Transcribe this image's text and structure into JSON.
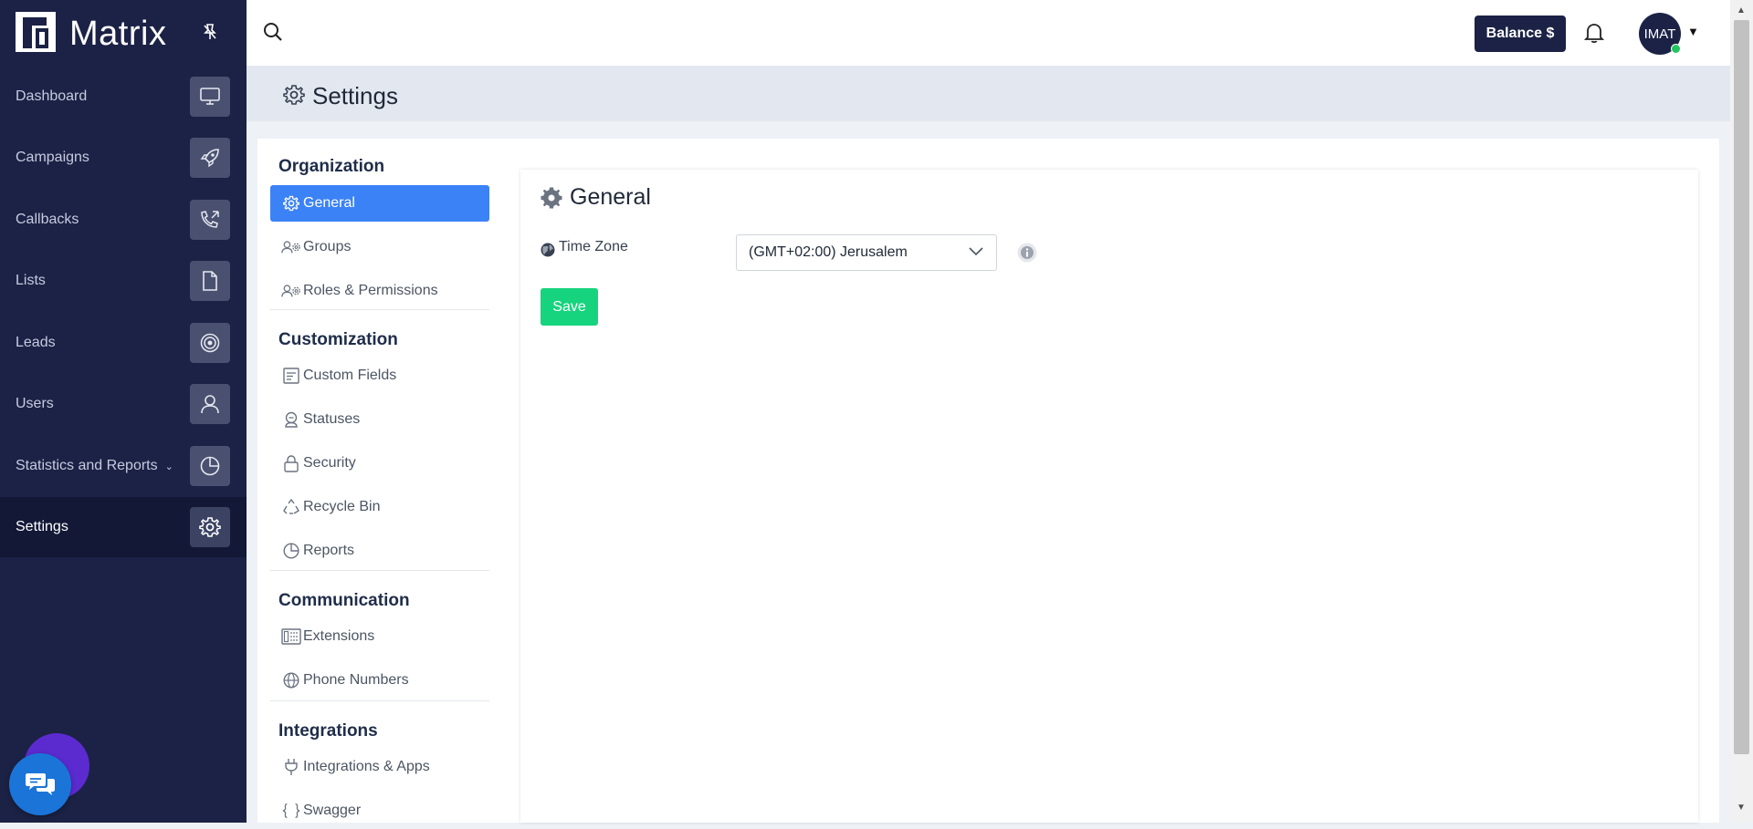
{
  "app": {
    "name": "Matrix"
  },
  "sidebar": {
    "items": [
      {
        "label": "Dashboard",
        "icon": "monitor-icon"
      },
      {
        "label": "Campaigns",
        "icon": "rocket-icon"
      },
      {
        "label": "Callbacks",
        "icon": "phone-callback-icon"
      },
      {
        "label": "Lists",
        "icon": "file-icon"
      },
      {
        "label": "Leads",
        "icon": "target-icon"
      },
      {
        "label": "Users",
        "icon": "user-icon"
      },
      {
        "label": "Statistics and Reports",
        "icon": "pie-chart-icon",
        "has_dropdown": true
      },
      {
        "label": "Settings",
        "icon": "gear-icon",
        "active": true
      }
    ]
  },
  "topbar": {
    "balance_label": "Balance $",
    "avatar_initials": "IMAT"
  },
  "page": {
    "title": "Settings"
  },
  "subnav": {
    "sections": [
      {
        "title": "Organization",
        "items": [
          {
            "label": "General",
            "icon": "gear-icon",
            "active": true
          },
          {
            "label": "Groups",
            "icon": "users-gear-icon"
          },
          {
            "label": "Roles & Permissions",
            "icon": "users-gear-icon"
          }
        ]
      },
      {
        "title": "Customization",
        "items": [
          {
            "label": "Custom Fields",
            "icon": "form-icon"
          },
          {
            "label": "Statuses",
            "icon": "status-icon"
          },
          {
            "label": "Security",
            "icon": "lock-icon"
          },
          {
            "label": "Recycle Bin",
            "icon": "recycle-icon"
          },
          {
            "label": "Reports",
            "icon": "pie-chart-icon"
          }
        ]
      },
      {
        "title": "Communication",
        "items": [
          {
            "label": "Extensions",
            "icon": "keypad-icon"
          },
          {
            "label": "Phone Numbers",
            "icon": "globe-icon"
          }
        ]
      },
      {
        "title": "Integrations",
        "items": [
          {
            "label": "Integrations & Apps",
            "icon": "plug-icon"
          },
          {
            "label": "Swagger",
            "icon": "braces-icon"
          }
        ]
      }
    ]
  },
  "general": {
    "title": "General",
    "timezone": {
      "label": "Time Zone",
      "value": "(GMT+02:00) Jerusalem"
    },
    "save_label": "Save"
  },
  "colors": {
    "sidebar_bg": "#1b2245",
    "active_subnav": "#3b82f6",
    "save_button": "#16d47e"
  }
}
